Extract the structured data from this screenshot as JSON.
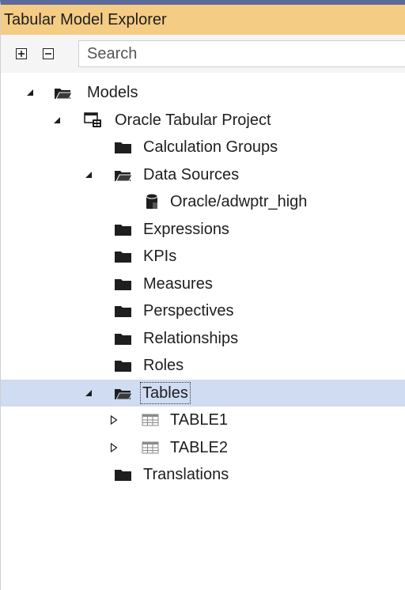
{
  "panel": {
    "title": "Tabular Model Explorer"
  },
  "toolbar": {
    "search_placeholder": "Search"
  },
  "tree": {
    "models": "Models",
    "project": "Oracle Tabular Project",
    "calculation_groups": "Calculation Groups",
    "data_sources": "Data Sources",
    "data_source_item": "Oracle/adwptr_high",
    "expressions": "Expressions",
    "kpis": "KPIs",
    "measures": "Measures",
    "perspectives": "Perspectives",
    "relationships": "Relationships",
    "roles": "Roles",
    "tables": "Tables",
    "table1": "TABLE1",
    "table2": "TABLE2",
    "translations": "Translations"
  },
  "colors": {
    "title_bar": "#f5cc84",
    "selection": "#cfdcf2",
    "folder": "#1e1e1e",
    "top_accent": "#5b6a9a"
  }
}
